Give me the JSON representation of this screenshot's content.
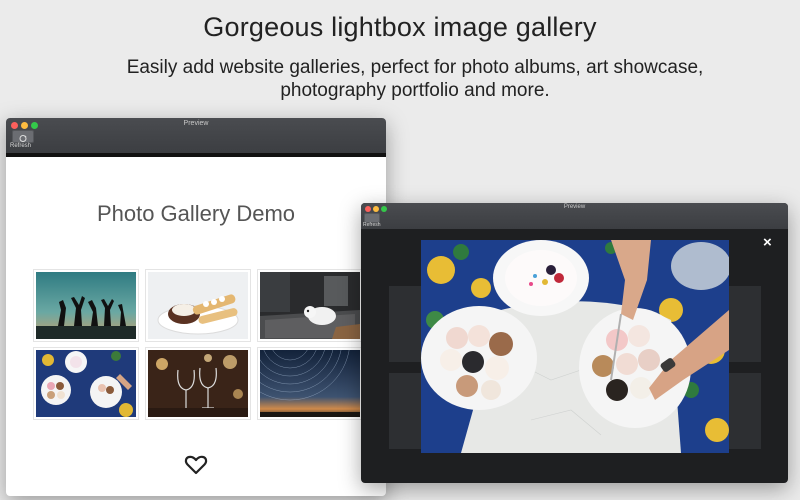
{
  "hero": {
    "headline": "Gorgeous lightbox image gallery",
    "subline": "Easily add website galleries, perfect for photo albums, art showcase, photography portfolio and more."
  },
  "preview_window": {
    "title": "Preview",
    "refresh_label": "Refresh",
    "page_title": "Photo Gallery Demo",
    "thumbnails": [
      {
        "name": "silhouettes-sunset"
      },
      {
        "name": "waffle-dessert"
      },
      {
        "name": "dog-on-rug"
      },
      {
        "name": "cupcakes-table"
      },
      {
        "name": "wine-glasses"
      },
      {
        "name": "star-trails"
      }
    ],
    "footer_icon": "heart-icon"
  },
  "lightbox_window": {
    "title": "Preview",
    "refresh_label": "Refresh",
    "close_icon": "close-icon",
    "close_symbol": "×",
    "photo": "cupcakes-and-cake-table"
  },
  "colors": {
    "background": "#ebebeb",
    "titlebar": "#3f4145",
    "lightbox_bg": "#1e1f21",
    "traffic_red": "#fc605c",
    "traffic_yellow": "#fdbc40",
    "traffic_green": "#34c84a"
  }
}
